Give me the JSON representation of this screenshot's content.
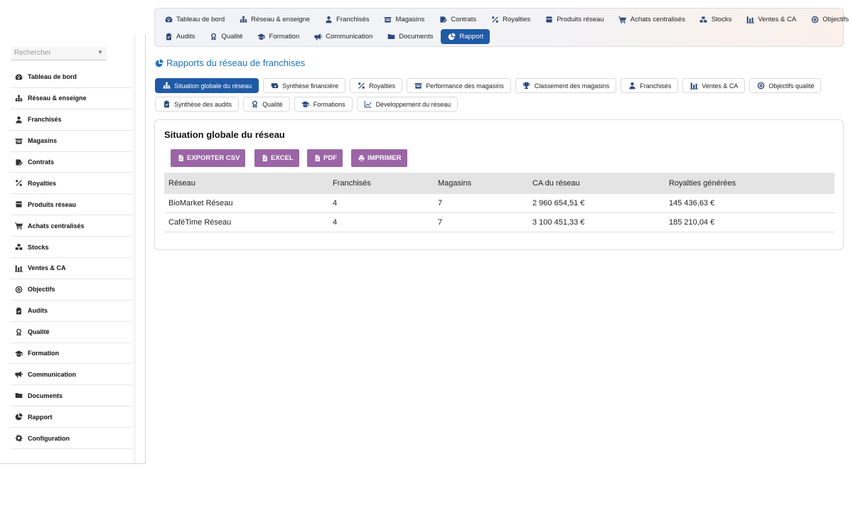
{
  "top_nav": {
    "row1": [
      {
        "label": "Tableau de bord",
        "icon": "dashboard-icon"
      },
      {
        "label": "Réseau & enseigne",
        "icon": "network-icon"
      },
      {
        "label": "Franchisés",
        "icon": "user-icon"
      },
      {
        "label": "Magasins",
        "icon": "store-icon"
      },
      {
        "label": "Contrats",
        "icon": "contract-icon"
      },
      {
        "label": "Royalties",
        "icon": "percent-icon"
      },
      {
        "label": "Produits réseau",
        "icon": "box-icon"
      },
      {
        "label": "Achats centralisés",
        "icon": "cart-icon"
      },
      {
        "label": "Stocks",
        "icon": "stock-icon"
      },
      {
        "label": "Ventes & CA",
        "icon": "sales-icon"
      },
      {
        "label": "Objectifs",
        "icon": "target-icon"
      }
    ],
    "row2": [
      {
        "label": "Audits",
        "icon": "clipboard-icon"
      },
      {
        "label": "Qualité",
        "icon": "award-icon"
      },
      {
        "label": "Formation",
        "icon": "graduation-cap-icon"
      },
      {
        "label": "Communication",
        "icon": "megaphone-icon"
      },
      {
        "label": "Documents",
        "icon": "folder-icon"
      },
      {
        "label": "Rapport",
        "icon": "pie-chart-icon"
      }
    ],
    "active": "Rapport"
  },
  "sidebar": {
    "search_placeholder": "Rechercher",
    "items": [
      {
        "label": "Tableau de bord",
        "icon": "dashboard-icon"
      },
      {
        "label": "Réseau & enseigne",
        "icon": "network-icon"
      },
      {
        "label": "Franchisés",
        "icon": "user-icon"
      },
      {
        "label": "Magasins",
        "icon": "store-icon"
      },
      {
        "label": "Contrats",
        "icon": "contract-icon"
      },
      {
        "label": "Royalties",
        "icon": "percent-icon"
      },
      {
        "label": "Produits réseau",
        "icon": "box-icon"
      },
      {
        "label": "Achats centralisés",
        "icon": "cart-icon"
      },
      {
        "label": "Stocks",
        "icon": "stock-icon"
      },
      {
        "label": "Ventes & CA",
        "icon": "sales-icon"
      },
      {
        "label": "Objectifs",
        "icon": "target-icon"
      },
      {
        "label": "Audits",
        "icon": "clipboard-icon"
      },
      {
        "label": "Qualité",
        "icon": "award-icon"
      },
      {
        "label": "Formation",
        "icon": "graduation-cap-icon"
      },
      {
        "label": "Communication",
        "icon": "megaphone-icon"
      },
      {
        "label": "Documents",
        "icon": "folder-icon"
      },
      {
        "label": "Rapport",
        "icon": "pie-chart-icon"
      },
      {
        "label": "Configuration",
        "icon": "gear-icon"
      }
    ]
  },
  "page": {
    "title": "Rapports du réseau de franchises",
    "title_icon": "pie-chart-icon"
  },
  "subtabs": {
    "row1": [
      {
        "label": "Situation globale du réseau",
        "icon": "network-icon"
      },
      {
        "label": "Synthèse financière",
        "icon": "money-icon"
      },
      {
        "label": "Royalties",
        "icon": "percent-icon"
      },
      {
        "label": "Performance des magasins",
        "icon": "store-icon"
      },
      {
        "label": "Classement des magasins",
        "icon": "trophy-icon"
      },
      {
        "label": "Franchisés",
        "icon": "user-icon"
      },
      {
        "label": "Ventes & CA",
        "icon": "sales-icon"
      },
      {
        "label": "Objectifs qualité",
        "icon": "target-icon"
      }
    ],
    "row2": [
      {
        "label": "Synthèse des audits",
        "icon": "clipboard-icon"
      },
      {
        "label": "Qualité",
        "icon": "award-icon"
      },
      {
        "label": "Formations",
        "icon": "graduation-cap-icon"
      },
      {
        "label": "Développement du réseau",
        "icon": "line-chart-icon"
      }
    ],
    "active": "Situation globale du réseau"
  },
  "report": {
    "title": "Situation globale du réseau",
    "buttons": {
      "csv": "EXPORTER CSV",
      "excel": "EXCEL",
      "pdf": "PDF",
      "print": "IMPRIMER"
    },
    "columns": [
      "Réseau",
      "Franchisés",
      "Magasins",
      "CA du réseau",
      "Royalties générées"
    ],
    "rows": [
      [
        "BioMarket Réseau",
        "4",
        "7",
        "2 960 654,51 €",
        "145 436,63 €"
      ],
      [
        "CaféTime Réseau",
        "4",
        "7",
        "3 100 451,33 €",
        "185 210,04 €"
      ]
    ]
  },
  "colors": {
    "accent": "#1f5aa6",
    "link": "#1f73b7",
    "export_button": "#9b65a6"
  }
}
